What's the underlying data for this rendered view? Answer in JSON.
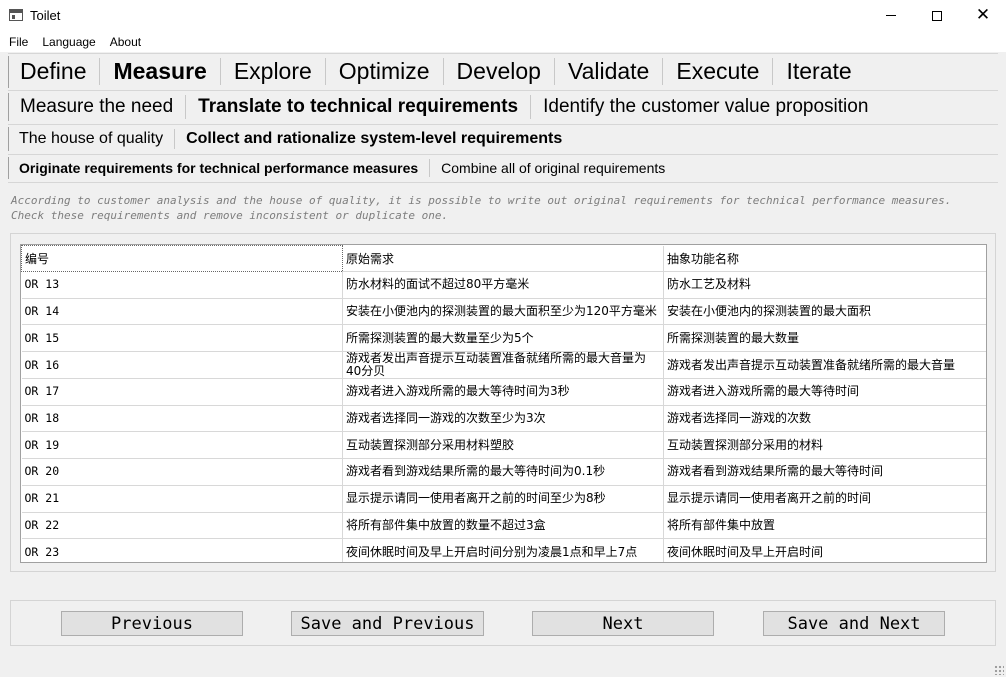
{
  "window": {
    "title": "Toilet",
    "icon": "app-window-icon",
    "controls": [
      "minimize-icon",
      "maximize-icon",
      "close-icon"
    ]
  },
  "menu": [
    "File",
    "Language",
    "About"
  ],
  "tabs_level1": {
    "items": [
      "Define",
      "Measure",
      "Explore",
      "Optimize",
      "Develop",
      "Validate",
      "Execute",
      "Iterate"
    ],
    "selected": "Measure"
  },
  "tabs_level2": {
    "items": [
      "Measure the need",
      "Translate to technical requirements",
      "Identify the customer value proposition"
    ],
    "selected": "Translate to technical requirements"
  },
  "tabs_level3": {
    "items": [
      "The house of quality",
      "Collect and rationalize system-level requirements"
    ],
    "selected": "Collect and rationalize system-level requirements"
  },
  "tabs_level4": {
    "items": [
      "Originate requirements for technical performance measures",
      "Combine all of original requirements"
    ],
    "selected": "Originate requirements for technical performance measures"
  },
  "description": "According to customer analysis and the house of quality, it is possible to write out original requirements for technical performance measures. Check these requirements and remove inconsistent or duplicate one.",
  "table": {
    "headers": [
      "编号",
      "原始需求",
      "抽象功能名称"
    ],
    "rows": [
      [
        "OR 13",
        "防水材料的面试不超过80平方毫米",
        "防水工艺及材料"
      ],
      [
        "OR 14",
        "安装在小便池内的探测装置的最大面积至少为120平方毫米",
        "安装在小便池内的探测装置的最大面积"
      ],
      [
        "OR 15",
        "所需探测装置的最大数量至少为5个",
        "所需探测装置的最大数量"
      ],
      [
        "OR 16",
        "游戏者发出声音提示互动装置准备就绪所需的最大音量为40分贝",
        "游戏者发出声音提示互动装置准备就绪所需的最大音量"
      ],
      [
        "OR 17",
        "游戏者进入游戏所需的最大等待时间为3秒",
        "游戏者进入游戏所需的最大等待时间"
      ],
      [
        "OR 18",
        "游戏者选择同一游戏的次数至少为3次",
        "游戏者选择同一游戏的次数"
      ],
      [
        "OR 19",
        "互动装置探测部分采用材料塑胶",
        "互动装置探测部分采用的材料"
      ],
      [
        "OR 20",
        "游戏者看到游戏结果所需的最大等待时间为0.1秒",
        "游戏者看到游戏结果所需的最大等待时间"
      ],
      [
        "OR 21",
        "显示提示请同一使用者离开之前的时间至少为8秒",
        "显示提示请同一使用者离开之前的时间"
      ],
      [
        "OR 22",
        "将所有部件集中放置的数量不超过3盒",
        "将所有部件集中放置"
      ],
      [
        "OR 23",
        "夜间休眠时间及早上开启时间分别为凌晨1点和早上7点",
        "夜间休眠时间及早上开启时间"
      ]
    ]
  },
  "buttons": {
    "previous": "Previous",
    "save_previous": "Save and Previous",
    "next": "Next",
    "save_next": "Save and Next"
  }
}
